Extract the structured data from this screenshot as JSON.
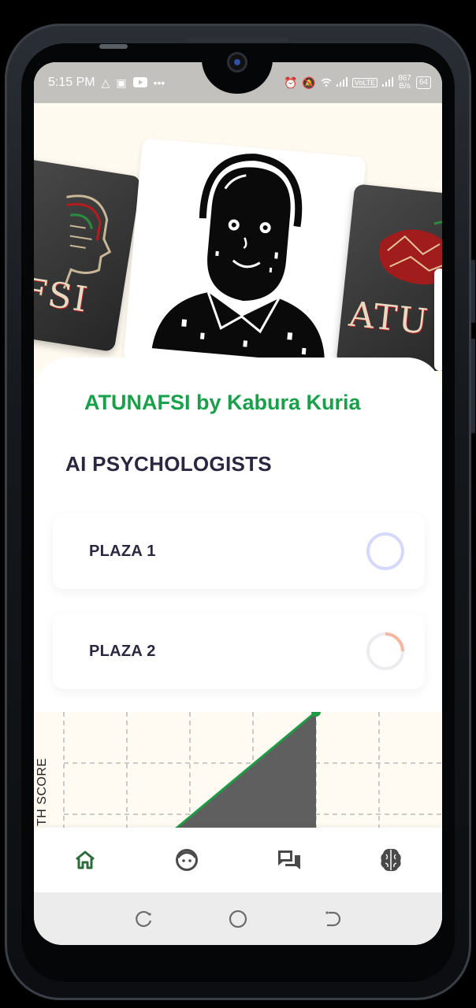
{
  "status_bar": {
    "time": "5:15 PM",
    "left_icons": [
      "warning-icon",
      "parking-icon",
      "youtube-icon",
      "more-icon"
    ],
    "right_icons": [
      "alarm-icon",
      "mute-icon",
      "wifi-icon",
      "signal-icon",
      "volte-icon",
      "signal-icon"
    ],
    "volte": "VoLTE",
    "net_speed_value": "867",
    "net_speed_unit": "B/s",
    "battery": "64"
  },
  "carousel": {
    "left_card_text": "AFSI",
    "right_card_text": "ATU"
  },
  "header": {
    "app_title": "ATUNAFSI by Kabura Kuria",
    "section_title": "AI PSYCHOLOGISTS"
  },
  "plazas": [
    {
      "label": "PLAZA 1",
      "ring_color": "#d6d9fb",
      "progress_color": "#d6d9fb"
    },
    {
      "label": "PLAZA 2",
      "ring_color": "#ececf0",
      "progress_color": "#f6b7a0"
    }
  ],
  "chart_data": {
    "type": "area",
    "ylabel": "TH SCORE",
    "line_color": "#1f9a45",
    "fill_color": "#5f5f5f",
    "grid": true,
    "grid_style": "dashed"
  },
  "bottom_nav": [
    {
      "name": "home",
      "icon": "home-icon",
      "active": true
    },
    {
      "name": "psychologist",
      "icon": "face-icon",
      "active": false
    },
    {
      "name": "chat",
      "icon": "chat-icon",
      "active": false
    },
    {
      "name": "brain",
      "icon": "brain-icon",
      "active": false
    }
  ],
  "system_nav": [
    "recent-apps-icon",
    "home-circle-icon",
    "back-icon"
  ],
  "colors": {
    "accent": "#18a04a",
    "title_text": "#2a2740",
    "background": "#fffcf4",
    "status_bar": "#c3c1be"
  }
}
